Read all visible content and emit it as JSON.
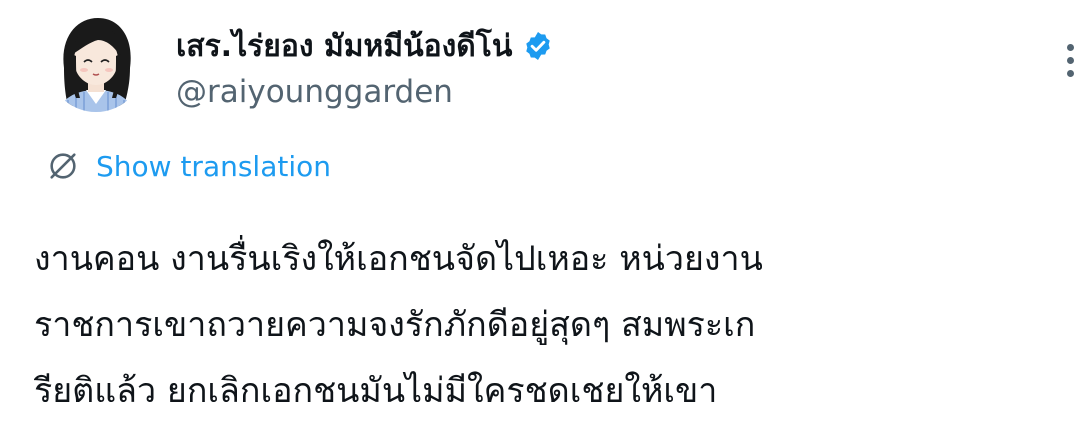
{
  "author": {
    "display_name": "เสร.ไร่ยอง มัมหมีน้องดีโน่",
    "handle": "@raiyounggarden",
    "verified": true,
    "verified_color": "#1d9bf0"
  },
  "translation": {
    "label": "Show translation",
    "icon": "globe-slash-icon",
    "color": "#1d9bf0"
  },
  "tweet": {
    "lines": [
      "งานคอน งานรื่นเริงให้เอกชนจัดไปเหอะ หน่วยงาน",
      "ราชการเขาถวายความจงรักภักดีอยู่สุดๆ สมพระเก",
      "รียติแล้ว  ยกเลิกเอกชนมันไม่มีใครชดเชยให้เขา"
    ]
  },
  "colors": {
    "text_primary": "#0f1419",
    "text_secondary": "#536471",
    "accent": "#1d9bf0",
    "background": "#ffffff"
  }
}
